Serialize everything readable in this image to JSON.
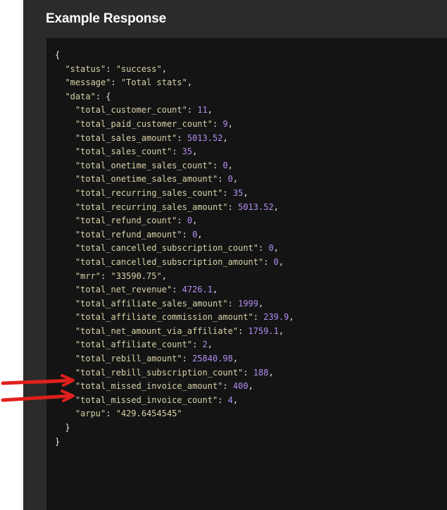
{
  "panel": {
    "title": "Example Response"
  },
  "response": {
    "open_brace": "{",
    "close_brace": "}",
    "fields": [
      {
        "key": "\"status\"",
        "value": "\"success\"",
        "type": "string"
      },
      {
        "key": "\"message\"",
        "value": "\"Total stats\"",
        "type": "string"
      }
    ],
    "data_key": "\"data\"",
    "data_open": "{",
    "data_close": "}",
    "data_fields": [
      {
        "key": "\"total_customer_count\"",
        "value": "11",
        "type": "number"
      },
      {
        "key": "\"total_paid_customer_count\"",
        "value": "9",
        "type": "number"
      },
      {
        "key": "\"total_sales_amount\"",
        "value": "5013.52",
        "type": "number"
      },
      {
        "key": "\"total_sales_count\"",
        "value": "35",
        "type": "number"
      },
      {
        "key": "\"total_onetime_sales_count\"",
        "value": "0",
        "type": "number"
      },
      {
        "key": "\"total_onetime_sales_amount\"",
        "value": "0",
        "type": "number"
      },
      {
        "key": "\"total_recurring_sales_count\"",
        "value": "35",
        "type": "number"
      },
      {
        "key": "\"total_recurring_sales_amount\"",
        "value": "5013.52",
        "type": "number"
      },
      {
        "key": "\"total_refund_count\"",
        "value": "0",
        "type": "number"
      },
      {
        "key": "\"total_refund_amount\"",
        "value": "0",
        "type": "number"
      },
      {
        "key": "\"total_cancelled_subscription_count\"",
        "value": "0",
        "type": "number"
      },
      {
        "key": "\"total_cancelled_subscription_amount\"",
        "value": "0",
        "type": "number"
      },
      {
        "key": "\"mrr\"",
        "value": "\"33590.75\"",
        "type": "string"
      },
      {
        "key": "\"total_net_revenue\"",
        "value": "4726.1",
        "type": "number"
      },
      {
        "key": "\"total_affiliate_sales_amount\"",
        "value": "1999",
        "type": "number"
      },
      {
        "key": "\"total_affiliate_commission_amount\"",
        "value": "239.9",
        "type": "number"
      },
      {
        "key": "\"total_net_amount_via_affiliate\"",
        "value": "1759.1",
        "type": "number"
      },
      {
        "key": "\"total_affiliate_count\"",
        "value": "2",
        "type": "number"
      },
      {
        "key": "\"total_rebill_amount\"",
        "value": "25840.98",
        "type": "number"
      },
      {
        "key": "\"total_rebill_subscription_count\"",
        "value": "188",
        "type": "number"
      },
      {
        "key": "\"total_missed_invoice_amount\"",
        "value": "400",
        "type": "number"
      },
      {
        "key": "\"total_missed_invoice_count\"",
        "value": "4",
        "type": "number"
      },
      {
        "key": "\"arpu\"",
        "value": "\"429.6454545\"",
        "type": "string"
      }
    ]
  },
  "colors": {
    "panel_bg": "#2b2b2b",
    "code_bg": "#141414",
    "key": "#d8d2a8",
    "number": "#b28ef0",
    "arrow": "#e0201c"
  },
  "annotations": {
    "arrow_targets": [
      "total_missed_invoice_amount",
      "total_missed_invoice_count"
    ]
  }
}
